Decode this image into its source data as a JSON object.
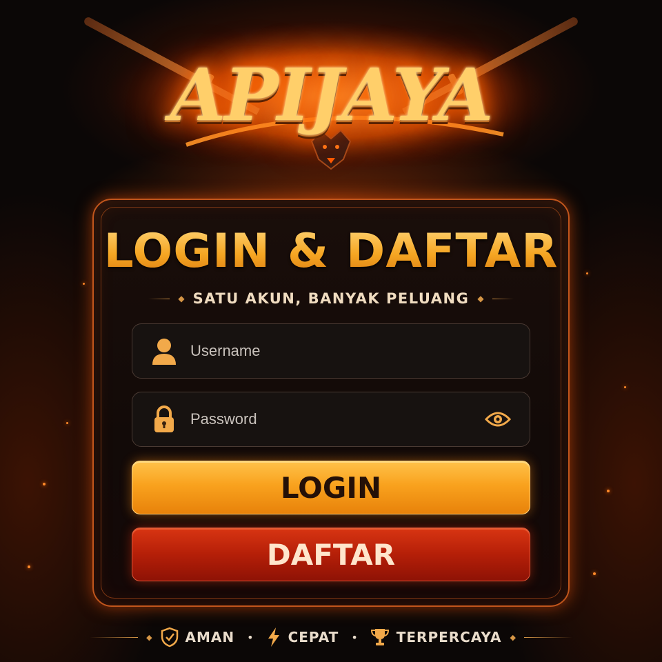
{
  "brand": {
    "logo_text": "APIJAYA"
  },
  "login_panel": {
    "title": "LOGIN & DAFTAR",
    "subtitle": "SATU AKUN, BANYAK PELUANG",
    "username": {
      "placeholder": "Username",
      "value": "",
      "icon": "user-icon"
    },
    "password": {
      "placeholder": "Password",
      "value": "",
      "icon": "lock-icon",
      "toggle_icon": "eye-icon"
    },
    "login_button": "LOGIN",
    "register_button": "DAFTAR"
  },
  "footer": {
    "items": [
      {
        "label": "AMAN",
        "icon": "shield-check-icon"
      },
      {
        "label": "CEPAT",
        "icon": "lightning-icon"
      },
      {
        "label": "TERPERCAYA",
        "icon": "trophy-icon"
      }
    ]
  },
  "colors": {
    "accent_gold": "#f7b43c",
    "fire_orange": "#ff6a00",
    "login_button": "#f9a21e",
    "register_button": "#b51f08",
    "background": "#0b0706"
  }
}
